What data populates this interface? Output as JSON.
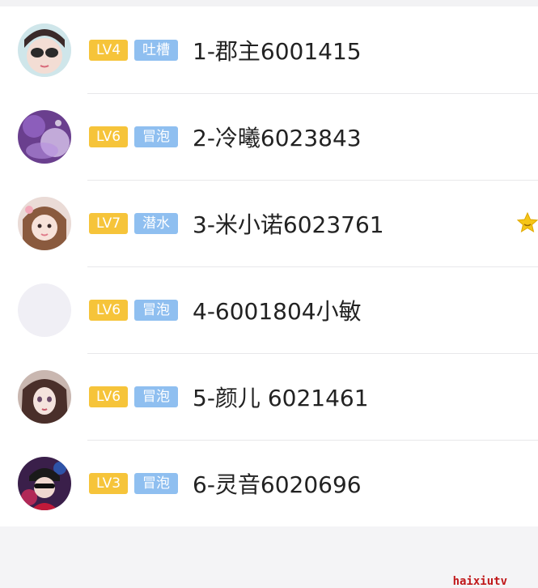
{
  "rows": [
    {
      "level": "LV4",
      "tag": "吐槽",
      "name": "1-郡主6001415"
    },
    {
      "level": "LV6",
      "tag": "冒泡",
      "name": "2-冷曦6023843"
    },
    {
      "level": "LV7",
      "tag": "潜水",
      "name": "3-米小诺6023761"
    },
    {
      "level": "LV6",
      "tag": "冒泡",
      "name": "4-6001804小敏"
    },
    {
      "level": "LV6",
      "tag": "冒泡",
      "name": "5-颜儿 6021461"
    },
    {
      "level": "LV3",
      "tag": "冒泡",
      "name": "6-灵音6020696"
    }
  ],
  "watermark": "haixiutv",
  "colors": {
    "level_badge": "#f6c43a",
    "tag_badge": "#8fbff0",
    "star": "#f5c518"
  },
  "icons": [
    "avatar-1",
    "avatar-2",
    "avatar-3",
    "avatar-4-empty",
    "avatar-5",
    "avatar-6",
    "star-icon"
  ]
}
